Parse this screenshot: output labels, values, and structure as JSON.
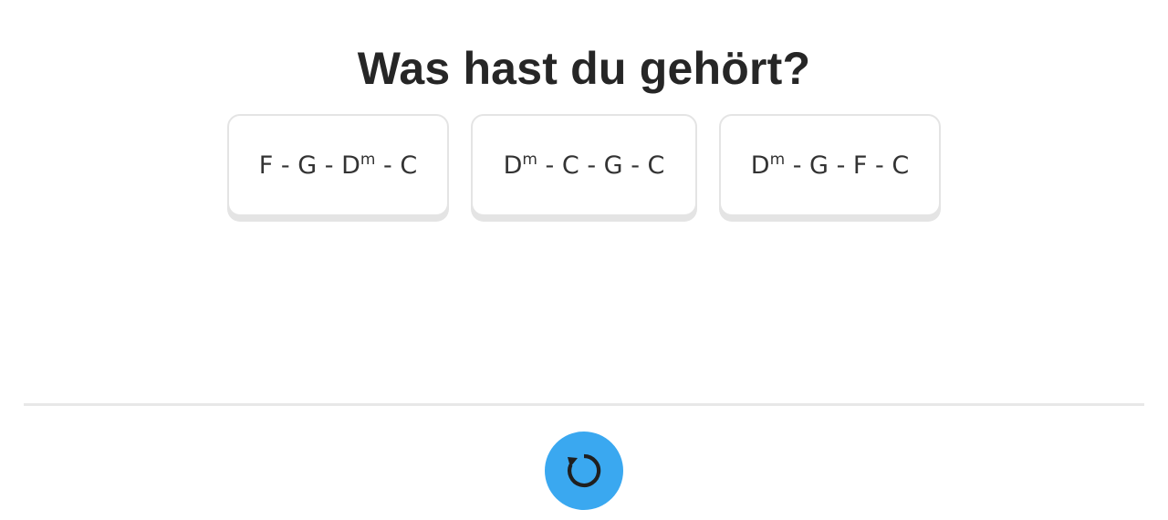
{
  "question": {
    "title": "Was hast du gehört?"
  },
  "options": [
    {
      "segments": [
        {
          "root": "F",
          "suffix": ""
        },
        {
          "root": "G",
          "suffix": ""
        },
        {
          "root": "D",
          "suffix": "m"
        },
        {
          "root": "C",
          "suffix": ""
        }
      ]
    },
    {
      "segments": [
        {
          "root": "D",
          "suffix": "m"
        },
        {
          "root": "C",
          "suffix": ""
        },
        {
          "root": "G",
          "suffix": ""
        },
        {
          "root": "C",
          "suffix": ""
        }
      ]
    },
    {
      "segments": [
        {
          "root": "D",
          "suffix": "m"
        },
        {
          "root": "G",
          "suffix": ""
        },
        {
          "root": "F",
          "suffix": ""
        },
        {
          "root": "C",
          "suffix": ""
        }
      ]
    }
  ],
  "separator": " - ",
  "replay_button": {
    "icon": "replay-icon",
    "color": "#3aa8f0"
  },
  "colors": {
    "card_border": "#e4e4e4",
    "divider": "#e8e8e8",
    "text": "#262626"
  }
}
